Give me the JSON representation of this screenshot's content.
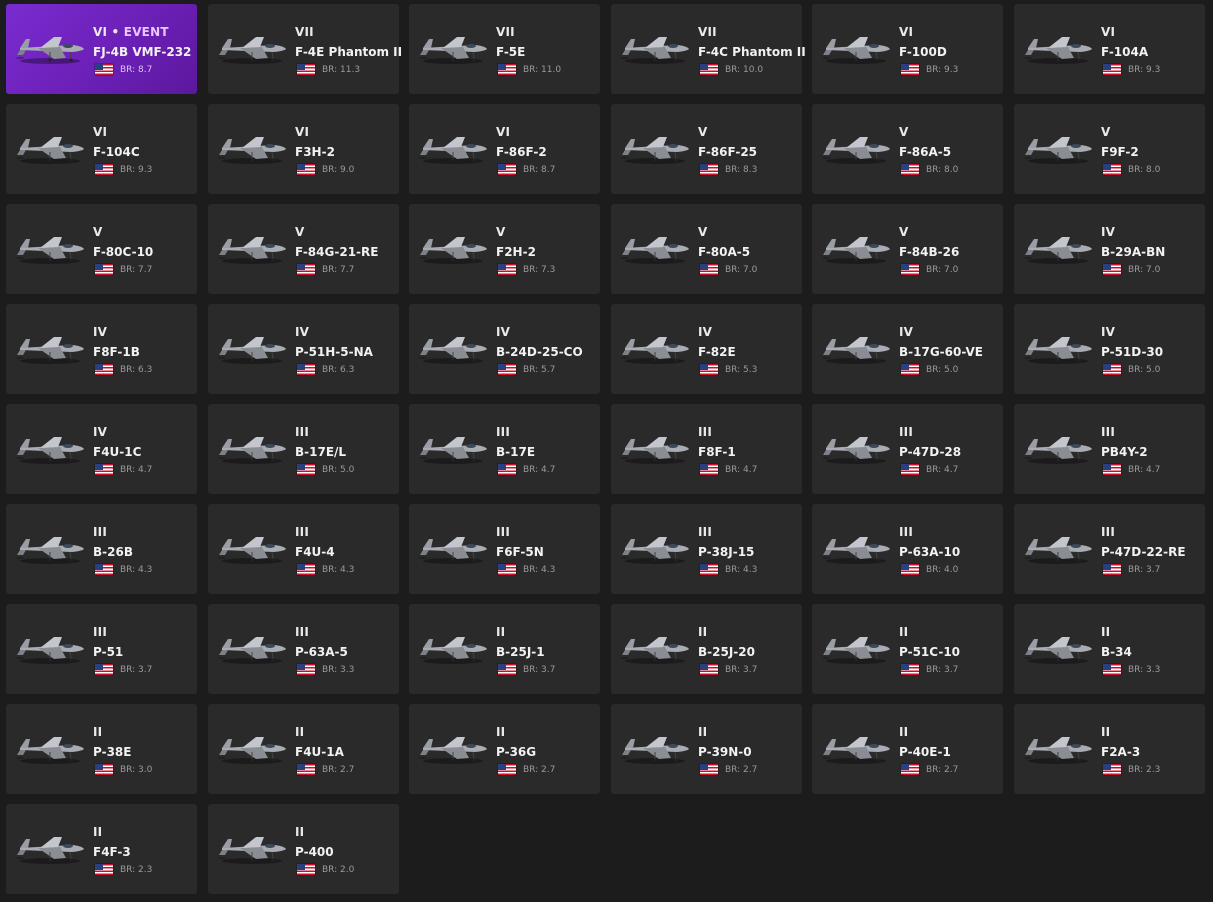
{
  "colors": {
    "page_background": "#1c1c1c",
    "card_background": "#2a2a2a",
    "event_card_background": "#7a2bd0",
    "br_text": "#9a9a9a"
  },
  "icons": {
    "flag": "usa-flag-icon",
    "aircraft": "aircraft-thumbnail-icon"
  },
  "vehicles": [
    {
      "rank": "VI",
      "event_label": "EVENT",
      "name": "FJ-4B VMF-232",
      "br": "BR: 8.7",
      "event": true
    },
    {
      "rank": "VII",
      "name": "F-4E Phantom II",
      "br": "BR: 11.3"
    },
    {
      "rank": "VII",
      "name": "F-5E",
      "br": "BR: 11.0"
    },
    {
      "rank": "VII",
      "name": "F-4C Phantom II",
      "br": "BR: 10.0"
    },
    {
      "rank": "VI",
      "name": "F-100D",
      "br": "BR: 9.3"
    },
    {
      "rank": "VI",
      "name": "F-104A",
      "br": "BR: 9.3"
    },
    {
      "rank": "VI",
      "name": "F-104C",
      "br": "BR: 9.3"
    },
    {
      "rank": "VI",
      "name": "F3H-2",
      "br": "BR: 9.0"
    },
    {
      "rank": "VI",
      "name": "F-86F-2",
      "br": "BR: 8.7"
    },
    {
      "rank": "V",
      "name": "F-86F-25",
      "br": "BR: 8.3"
    },
    {
      "rank": "V",
      "name": "F-86A-5",
      "br": "BR: 8.0"
    },
    {
      "rank": "V",
      "name": "F9F-2",
      "br": "BR: 8.0"
    },
    {
      "rank": "V",
      "name": "F-80C-10",
      "br": "BR: 7.7"
    },
    {
      "rank": "V",
      "name": "F-84G-21-RE",
      "br": "BR: 7.7"
    },
    {
      "rank": "V",
      "name": "F2H-2",
      "br": "BR: 7.3"
    },
    {
      "rank": "V",
      "name": "F-80A-5",
      "br": "BR: 7.0"
    },
    {
      "rank": "V",
      "name": "F-84B-26",
      "br": "BR: 7.0"
    },
    {
      "rank": "IV",
      "name": "B-29A-BN",
      "br": "BR: 7.0"
    },
    {
      "rank": "IV",
      "name": "F8F-1B",
      "br": "BR: 6.3"
    },
    {
      "rank": "IV",
      "name": "P-51H-5-NA",
      "br": "BR: 6.3"
    },
    {
      "rank": "IV",
      "name": "B-24D-25-CO",
      "br": "BR: 5.7"
    },
    {
      "rank": "IV",
      "name": "F-82E",
      "br": "BR: 5.3"
    },
    {
      "rank": "IV",
      "name": "B-17G-60-VE",
      "br": "BR: 5.0"
    },
    {
      "rank": "IV",
      "name": "P-51D-30",
      "br": "BR: 5.0"
    },
    {
      "rank": "IV",
      "name": "F4U-1C",
      "br": "BR: 4.7"
    },
    {
      "rank": "III",
      "name": "B-17E/L",
      "br": "BR: 5.0"
    },
    {
      "rank": "III",
      "name": "B-17E",
      "br": "BR: 4.7"
    },
    {
      "rank": "III",
      "name": "F8F-1",
      "br": "BR: 4.7"
    },
    {
      "rank": "III",
      "name": "P-47D-28",
      "br": "BR: 4.7"
    },
    {
      "rank": "III",
      "name": "PB4Y-2",
      "br": "BR: 4.7"
    },
    {
      "rank": "III",
      "name": "B-26B",
      "br": "BR: 4.3"
    },
    {
      "rank": "III",
      "name": "F4U-4",
      "br": "BR: 4.3"
    },
    {
      "rank": "III",
      "name": "F6F-5N",
      "br": "BR: 4.3"
    },
    {
      "rank": "III",
      "name": "P-38J-15",
      "br": "BR: 4.3"
    },
    {
      "rank": "III",
      "name": "P-63A-10",
      "br": "BR: 4.0"
    },
    {
      "rank": "III",
      "name": "P-47D-22-RE",
      "br": "BR: 3.7"
    },
    {
      "rank": "III",
      "name": "P-51",
      "br": "BR: 3.7"
    },
    {
      "rank": "III",
      "name": "P-63A-5",
      "br": "BR: 3.3"
    },
    {
      "rank": "II",
      "name": "B-25J-1",
      "br": "BR: 3.7"
    },
    {
      "rank": "II",
      "name": "B-25J-20",
      "br": "BR: 3.7"
    },
    {
      "rank": "II",
      "name": "P-51C-10",
      "br": "BR: 3.7"
    },
    {
      "rank": "II",
      "name": "B-34",
      "br": "BR: 3.3"
    },
    {
      "rank": "II",
      "name": "P-38E",
      "br": "BR: 3.0"
    },
    {
      "rank": "II",
      "name": "F4U-1A",
      "br": "BR: 2.7"
    },
    {
      "rank": "II",
      "name": "P-36G",
      "br": "BR: 2.7"
    },
    {
      "rank": "II",
      "name": "P-39N-0",
      "br": "BR: 2.7"
    },
    {
      "rank": "II",
      "name": "P-40E-1",
      "br": "BR: 2.7"
    },
    {
      "rank": "II",
      "name": "F2A-3",
      "br": "BR: 2.3"
    },
    {
      "rank": "II",
      "name": "F4F-3",
      "br": "BR: 2.3"
    },
    {
      "rank": "II",
      "name": "P-400",
      "br": "BR: 2.0"
    }
  ]
}
